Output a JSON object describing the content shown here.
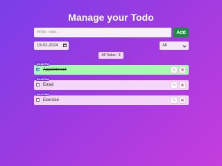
{
  "title": "Manage your Todo",
  "add_form": {
    "placeholder": "Write Todo...",
    "add_label": "Add"
  },
  "date_filter": {
    "value": "19-02-2024"
  },
  "status_filter": {
    "selected": "All"
  },
  "summary": {
    "label": "All Todos : 3"
  },
  "todos": [
    {
      "time": "09:46 PM",
      "text": "Appointment",
      "completed": true
    },
    {
      "time": "09:46 PM",
      "text": "Email",
      "completed": false
    },
    {
      "time": "09:47 PM",
      "text": "Exercise",
      "completed": false
    }
  ],
  "icons": {
    "edit": "pencil-icon",
    "delete": "close-icon",
    "calendar": "calendar-icon",
    "dropdown": "chevron-down-icon"
  },
  "colors": {
    "add": "#1f8a45",
    "completed_row": "#a8fbb0",
    "pending_row": "#f4d6f8",
    "time_badge": "#7b2be0",
    "delete": "#c62828"
  }
}
